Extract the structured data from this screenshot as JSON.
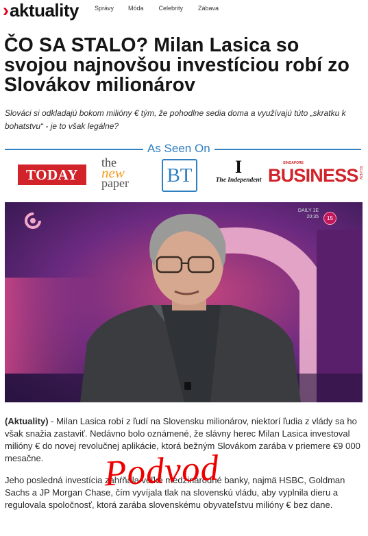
{
  "header": {
    "logo_chevron": "›",
    "logo_text": "aktuality",
    "nav": [
      "Správy",
      "Móda",
      "Celebrity",
      "Zábava"
    ]
  },
  "article": {
    "headline": "ČO SA STALO? Milan Lasica so svojou najnovšou investíciou robí zo Slovákov milionárov",
    "lead": "Slováci si odkladajú bokom milióny € tým, že pohodlne sedia doma a využívajú túto „skratku k bohatstvu“ - je to však legálne?",
    "as_seen_on": {
      "title": "As Seen On",
      "logos": {
        "today": "TODAY",
        "newpaper_1": "the",
        "newpaper_2": "new",
        "newpaper_3": "paper",
        "bt": "BT",
        "independent_mark": "I",
        "independent_name": "The Independent",
        "sbr_top": "SINGAPORE",
        "sbr_main": "BUSINESS",
        "sbr_side": "REVIEW"
      }
    },
    "video": {
      "channel_info_1": "DAILY 1E",
      "channel_info_2": "20:35",
      "badge": "15"
    },
    "source": "(Aktuality)",
    "para1": " - Milan Lasica robí z ľudí na Slovensku milionárov, niektorí ľudia z vlády sa ho však snažia zastaviť. Nedávno bolo oznámené, že slávny herec Milan Lasica investoval milióny € do novej revolučnej aplikácie, ktorá bežným Slovákom zarába v priemere €9 000 mesačne.",
    "para2": "Jeho posledná investícia zahŕňala veľké medzinárodné banky, najmä HSBC, Goldman Sachs a JP Morgan Chase, čím vyvíjala tlak na slovenskú vládu, aby vyplnila dieru a regulovala spoločnosť, ktorá zarába slovenskému obyvateľstvu milióny € bez dane."
  },
  "overlay": {
    "stamp": "Podvod"
  },
  "colors": {
    "brand_red": "#e2001a",
    "accent_blue": "#2f7fc1",
    "stamp_red": "#ee0000"
  }
}
